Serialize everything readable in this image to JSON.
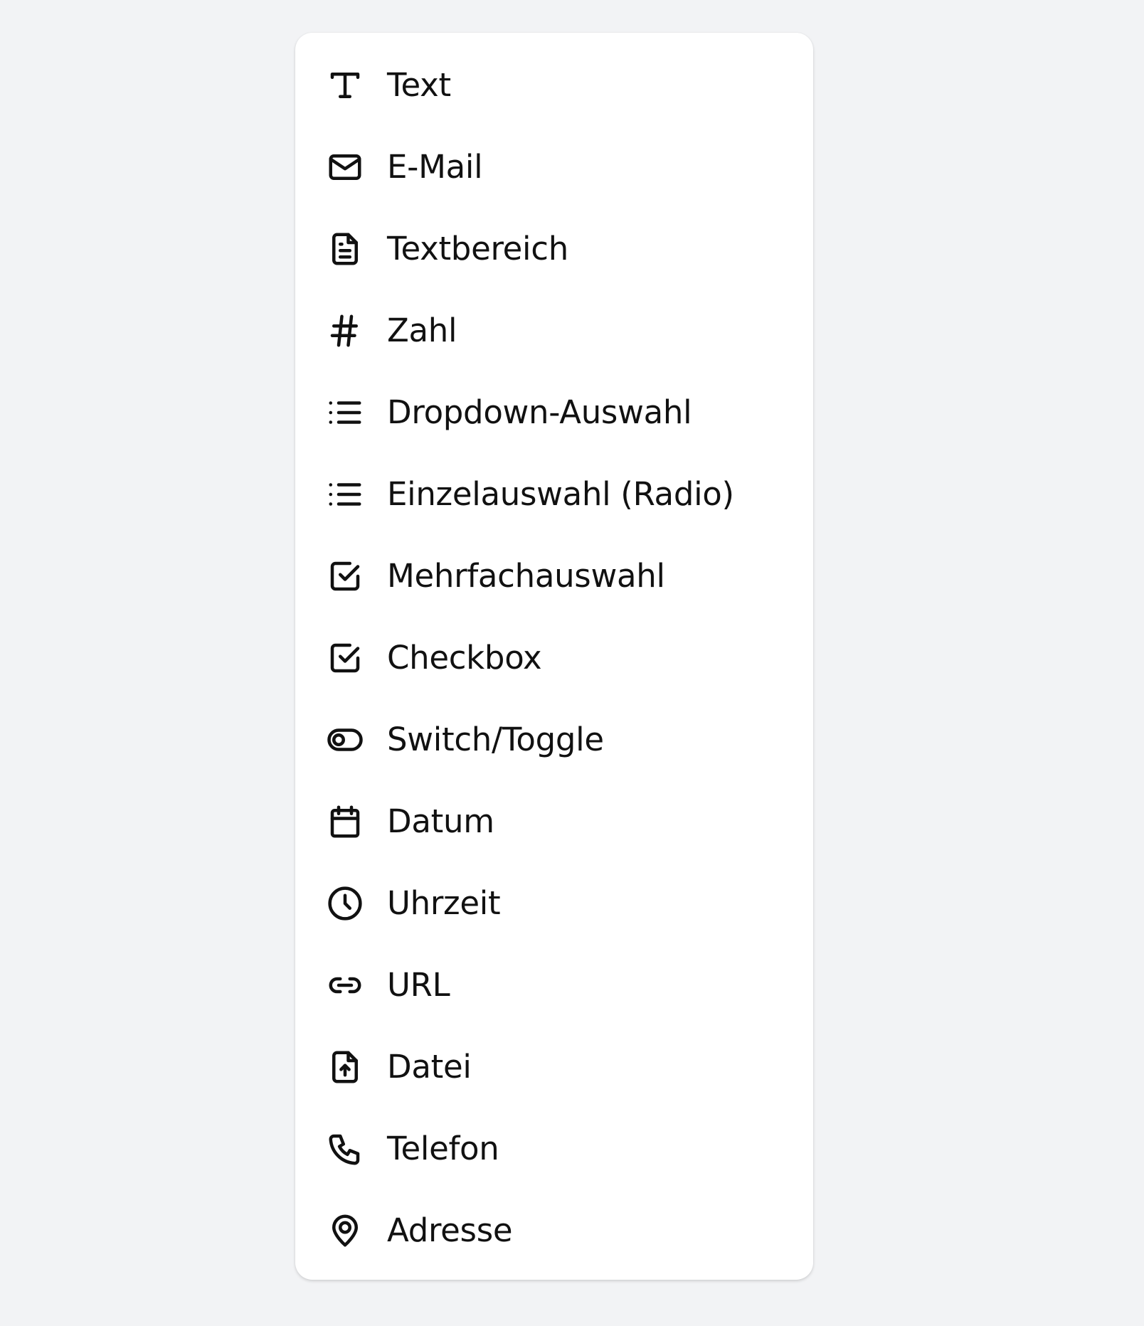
{
  "menu": {
    "items": [
      {
        "label": "Text",
        "icon": "text-icon"
      },
      {
        "label": "E-Mail",
        "icon": "mail-icon"
      },
      {
        "label": "Textbereich",
        "icon": "document-icon"
      },
      {
        "label": "Zahl",
        "icon": "hash-icon"
      },
      {
        "label": "Dropdown-Auswahl",
        "icon": "list-icon"
      },
      {
        "label": "Einzelauswahl (Radio)",
        "icon": "list-icon"
      },
      {
        "label": "Mehrfachauswahl",
        "icon": "checkbox-icon"
      },
      {
        "label": "Checkbox",
        "icon": "checkbox-icon"
      },
      {
        "label": "Switch/Toggle",
        "icon": "toggle-icon"
      },
      {
        "label": "Datum",
        "icon": "calendar-icon"
      },
      {
        "label": "Uhrzeit",
        "icon": "clock-icon"
      },
      {
        "label": "URL",
        "icon": "link-icon"
      },
      {
        "label": "Datei",
        "icon": "file-upload-icon"
      },
      {
        "label": "Telefon",
        "icon": "phone-icon"
      },
      {
        "label": "Adresse",
        "icon": "map-pin-icon"
      }
    ]
  },
  "colors": {
    "background": "#f2f3f5",
    "panel": "#ffffff",
    "text": "#111111"
  }
}
